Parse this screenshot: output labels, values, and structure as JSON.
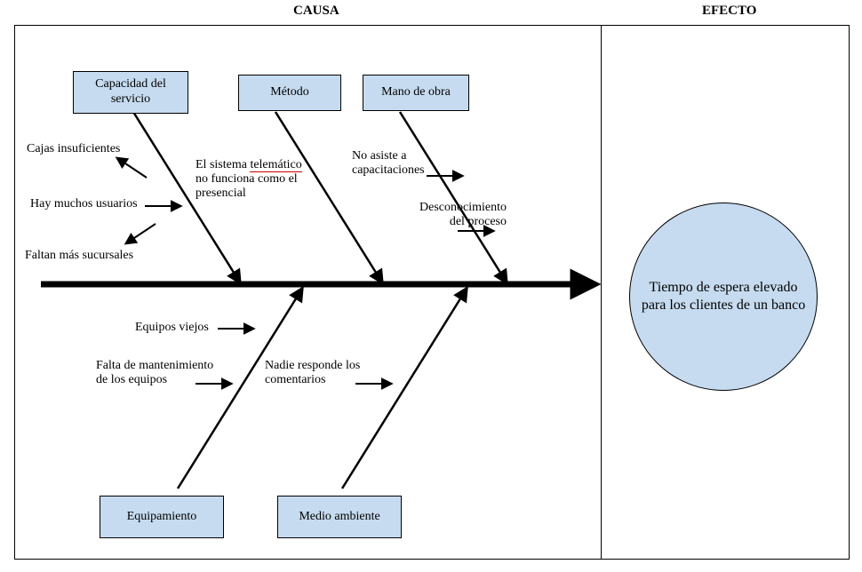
{
  "headers": {
    "causa": "CAUSA",
    "efecto": "EFECTO"
  },
  "categories": {
    "capacidad": "Capacidad del servicio",
    "metodo": "Método",
    "mano": "Mano de obra",
    "equipamiento": "Equipamiento",
    "medio": "Medio ambiente"
  },
  "causes": {
    "cajas": "Cajas insuficientes",
    "usuarios": "Hay muchos usuarios",
    "sucursales": "Faltan más sucursales",
    "telematico_l1": "El sistema ",
    "telematico_word": "telemático",
    "telematico_l2": "no funciona como el",
    "telematico_l3": "presencial",
    "capacitaciones_l1": "No asiste a",
    "capacitaciones_l2": "capacitaciones",
    "desconocimiento_l1": "Desconocimiento",
    "desconocimiento_l2": "del proceso",
    "equipos_viejos": "Equipos viejos",
    "mantenimiento_l1": "Falta de mantenimiento",
    "mantenimiento_l2": "de los equipos",
    "nadie_l1": "Nadie responde los",
    "nadie_l2": "comentarios"
  },
  "effect": "Tiempo de espera elevado para los clientes de un banco"
}
